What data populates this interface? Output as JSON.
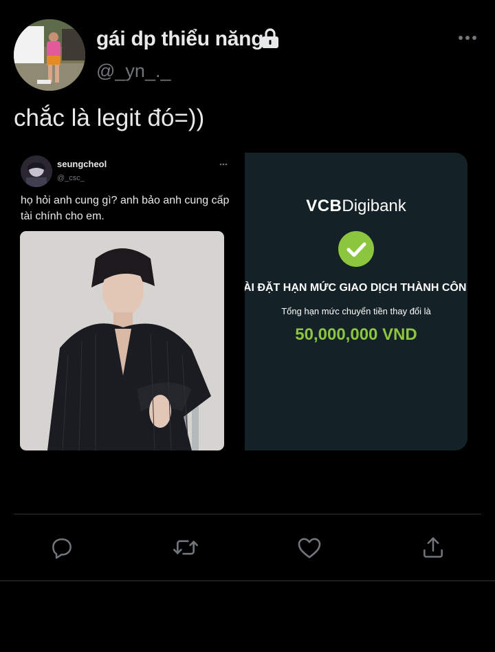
{
  "author": {
    "display_name": "gái dp thiểu năng",
    "handle": "@_yn_._",
    "protected_icon": "lock-icon"
  },
  "tweet": {
    "text": "chắc là legit đó=))"
  },
  "media": {
    "quoted_screenshot": {
      "name": "seungcheol",
      "handle": "@_csc_",
      "text": "họ hỏi anh cung gì? anh bảo anh cung cấp tài chính cho em."
    },
    "bank_screenshot": {
      "logo_main": "VCB",
      "logo_sub": "Digibank",
      "status": "ÀI ĐẶT HẠN MỨC GIAO DỊCH THÀNH CÔN",
      "subtitle": "Tổng hạn mức chuyển tiền thay đổi là",
      "amount": "50,000,000 VND"
    }
  },
  "actions": {
    "reply_icon": "reply-icon",
    "retweet_icon": "retweet-icon",
    "like_icon": "heart-icon",
    "share_icon": "share-icon"
  },
  "colors": {
    "background": "#000000",
    "text": "#e7e9ea",
    "secondary": "#71767b",
    "divider": "#2f3336",
    "vcb_green": "#8cc63f",
    "vcb_background": "#142127"
  }
}
